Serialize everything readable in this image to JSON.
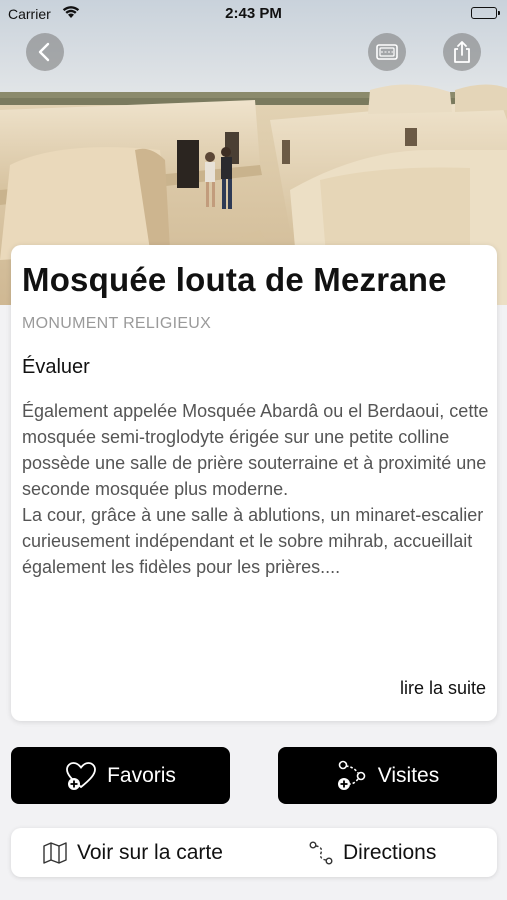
{
  "status_bar": {
    "carrier": "Carrier",
    "time": "2:43 PM"
  },
  "hero": {
    "icons": [
      "back-arrow-icon",
      "wallet-icon",
      "share-icon"
    ]
  },
  "card": {
    "title": "Mosquée louta de Mezrane",
    "category": "MONUMENT RELIGIEUX",
    "rate_label": "Évaluer",
    "description": "Également appelée Mosquée Abardâ ou el Berdaoui, cette mosquée semi-troglodyte érigée sur une petite colline possède une salle de prière souterraine et à proximité une seconde mosquée plus moderne.\nLa cour, grâce à une salle à ablutions, un minaret-escalier curieusement indépendant et le sobre mihrab, accueillait également les fidèles pour les prières....",
    "read_more_label": "lire la suite"
  },
  "actions": {
    "favorites_label": "Favoris",
    "visits_label": "Visites"
  },
  "bottom_bar": {
    "map_label": "Voir sur la carte",
    "directions_label": "Directions"
  },
  "colors": {
    "button_bg": "#000000",
    "button_text": "#ffffff",
    "category_text": "#9a9a9a",
    "body_text": "#555555"
  }
}
